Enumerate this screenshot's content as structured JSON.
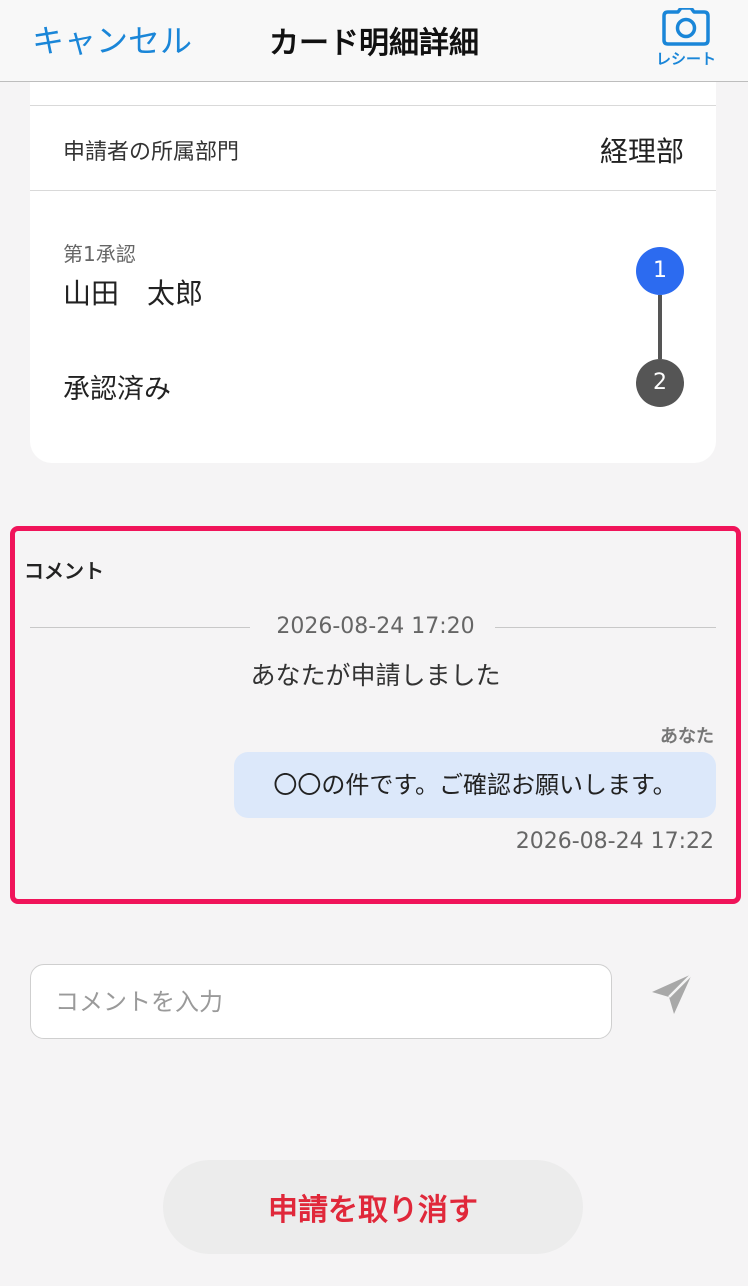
{
  "header": {
    "cancel_label": "キャンセル",
    "title": "カード明細詳細",
    "receipt_label": "レシート"
  },
  "details": {
    "department_label": "申請者の所属部門",
    "department_value": "経理部"
  },
  "approval": {
    "step1_caption": "第1承認",
    "step1_approver": "山田　太郎",
    "step1_number": "1",
    "status_label": "承認済み",
    "step2_number": "2"
  },
  "comments": {
    "title": "コメント",
    "system_timestamp": "2026-08-24 17:20",
    "system_message": "あなたが申請しました",
    "sender": "あなた",
    "message": "〇〇の件です。ご確認お願いします。",
    "message_timestamp": "2026-08-24 17:22"
  },
  "input": {
    "placeholder": "コメントを入力",
    "value": ""
  },
  "footer": {
    "cancel_request_label": "申請を取り消す"
  },
  "colors": {
    "accent": "#1a86d8",
    "step_active": "#2c6bf0",
    "step_pending": "#555555",
    "highlight_border": "#f0145a",
    "bubble": "#dce8fa",
    "danger": "#e0283a"
  },
  "icons": {
    "receipt": "camera-icon",
    "send": "send-icon"
  }
}
